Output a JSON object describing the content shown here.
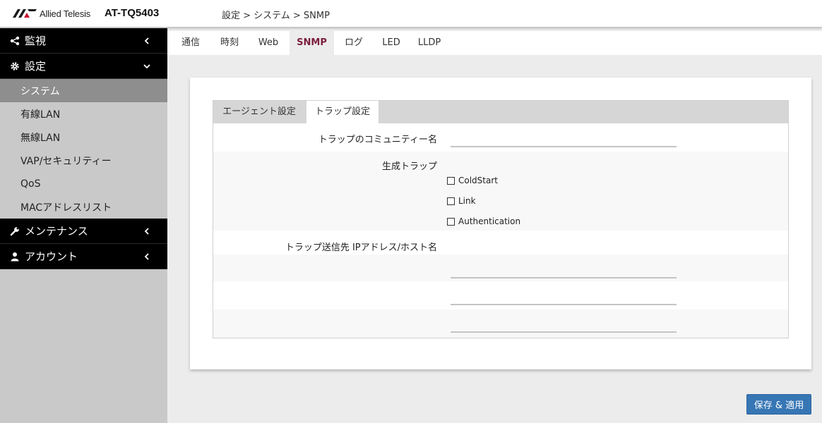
{
  "header": {
    "brand": "Allied Telesis",
    "model": "AT-TQ5403",
    "breadcrumb": "設定 > システム > SNMP"
  },
  "sidebar": {
    "sections": [
      {
        "label": "監視",
        "icon": "share-icon",
        "chevron": "chevron-left-icon"
      },
      {
        "label": "設定",
        "icon": "gear-icon",
        "chevron": "chevron-down-icon"
      },
      {
        "label": "メンテナンス",
        "icon": "wrench-icon",
        "chevron": "chevron-left-icon"
      },
      {
        "label": "アカウント",
        "icon": "user-icon",
        "chevron": "chevron-left-icon"
      }
    ],
    "settings_items": [
      {
        "label": "システム",
        "active": true
      },
      {
        "label": "有線LAN"
      },
      {
        "label": "無線LAN"
      },
      {
        "label": "VAP/セキュリティー"
      },
      {
        "label": "QoS"
      },
      {
        "label": "MACアドレスリスト"
      }
    ]
  },
  "tabs": [
    {
      "label": "通信"
    },
    {
      "label": "時刻"
    },
    {
      "label": "Web"
    },
    {
      "label": "SNMP",
      "active": true
    },
    {
      "label": "ログ"
    },
    {
      "label": "LED"
    },
    {
      "label": "LLDP"
    }
  ],
  "panel": {
    "tabs": [
      {
        "label": "エージェント設定"
      },
      {
        "label": "トラップ設定",
        "active": true
      }
    ],
    "community_label": "トラップのコミュニティー名",
    "community_value": "",
    "traps_label": "生成トラップ",
    "traps": [
      {
        "label": "ColdStart",
        "checked": false
      },
      {
        "label": "Link",
        "checked": false
      },
      {
        "label": "Authentication",
        "checked": false
      }
    ],
    "hosts_label": "トラップ送信先 IPアドレス/ホスト名",
    "hosts": [
      "",
      "",
      ""
    ]
  },
  "actions": {
    "save_label": "保存 & 適用"
  },
  "colors": {
    "accent": "#7a1f3d",
    "button": "#3776b4",
    "sidebar_header": "#000000",
    "sidebar_active": "#8e8e8e"
  }
}
